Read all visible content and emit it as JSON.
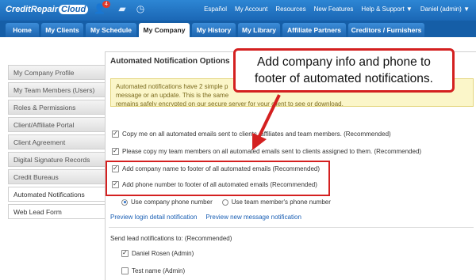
{
  "app": {
    "logo_text": "CreditRepair",
    "logo_cloud": "Cloud",
    "notification_count": "4"
  },
  "top_links": [
    "Español",
    "My Account",
    "Resources",
    "New Features",
    "Help & Support ▼",
    "Daniel (admin) ▼"
  ],
  "tabs": [
    "Home",
    "My Clients",
    "My Schedule",
    "My Company",
    "My History",
    "My Library",
    "Affiliate Partners",
    "Creditors / Furnishers"
  ],
  "active_tab": "My Company",
  "sidebar": {
    "items": [
      "My Company Profile",
      "My Team Members (Users)",
      "Roles & Permissions",
      "Client/Affiliate Portal",
      "Client Agreement",
      "Digital Signature Records",
      "Credit Bureaus",
      "Automated Notifications",
      "Web Lead Form"
    ],
    "active": "Automated Notifications"
  },
  "panel": {
    "title": "Automated Notification Options",
    "info_lines": [
      "Automated notifications have 2 simple p",
      "message or an update. This is the same",
      "remains safely encrypted on our secure server for your client to see or download."
    ],
    "checkboxes": [
      {
        "label": "Copy me on all automated emails sent to clients, affiliates and team members. (Recommended)",
        "checked": true
      },
      {
        "label": "Please copy my team members on all automated emails sent to clients assigned to them. (Recommended)",
        "checked": true
      },
      {
        "label": "Add company name to footer of all automated emails (Recommended)",
        "checked": true
      },
      {
        "label": "Add phone number to footer of all automated emails (Recommended)",
        "checked": true
      }
    ],
    "radio_company": "Use company phone number",
    "radio_team": "Use team member's phone number",
    "link_login": "Preview login detail notification",
    "link_message": "Preview new message notification",
    "lead_title": "Send lead notifications to: (Recommended)",
    "lead_recipients": [
      {
        "label": "Daniel Rosen (Admin)",
        "checked": true
      },
      {
        "label": "Test name (Admin)",
        "checked": false
      }
    ]
  },
  "callout": {
    "line1": "Add company info and phone to",
    "line2": "footer of automated notifications."
  },
  "colors": {
    "accent": "#1e6bb8",
    "annotation_red": "#d42020",
    "info_bg": "#fbf6c9"
  }
}
